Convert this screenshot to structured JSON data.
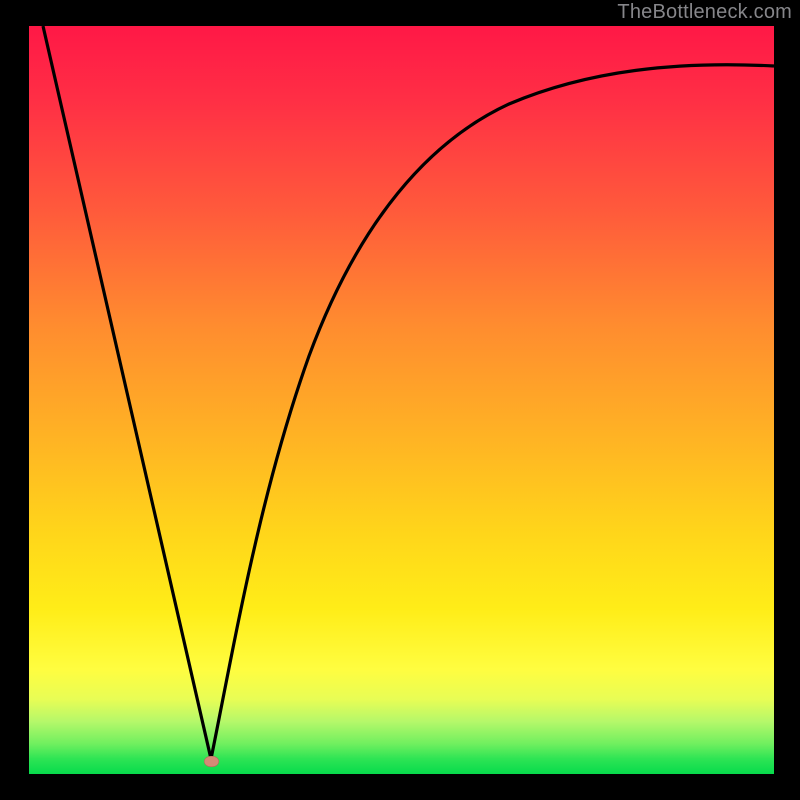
{
  "watermark": "TheBottleneck.com",
  "chart_data": {
    "type": "line",
    "title": "",
    "xlabel": "",
    "ylabel": "",
    "xlim": [
      0,
      100
    ],
    "ylim": [
      0,
      100
    ],
    "grid": false,
    "series": [
      {
        "name": "curve",
        "x": [
          2,
          24,
          25,
          26,
          28,
          30,
          33,
          38,
          45,
          55,
          65,
          75,
          85,
          100
        ],
        "values": [
          100,
          2,
          0,
          2,
          12,
          24,
          38,
          54,
          68,
          80,
          86,
          90,
          92.5,
          94.5
        ]
      }
    ],
    "markers": [
      {
        "name": "minimum",
        "x": 25,
        "y": 0
      }
    ],
    "gradient_bands": [
      {
        "color": "#ff1846",
        "at": 100
      },
      {
        "color": "#ffb324",
        "at": 45
      },
      {
        "color": "#fffd40",
        "at": 14
      },
      {
        "color": "#07db4c",
        "at": 0
      }
    ]
  }
}
